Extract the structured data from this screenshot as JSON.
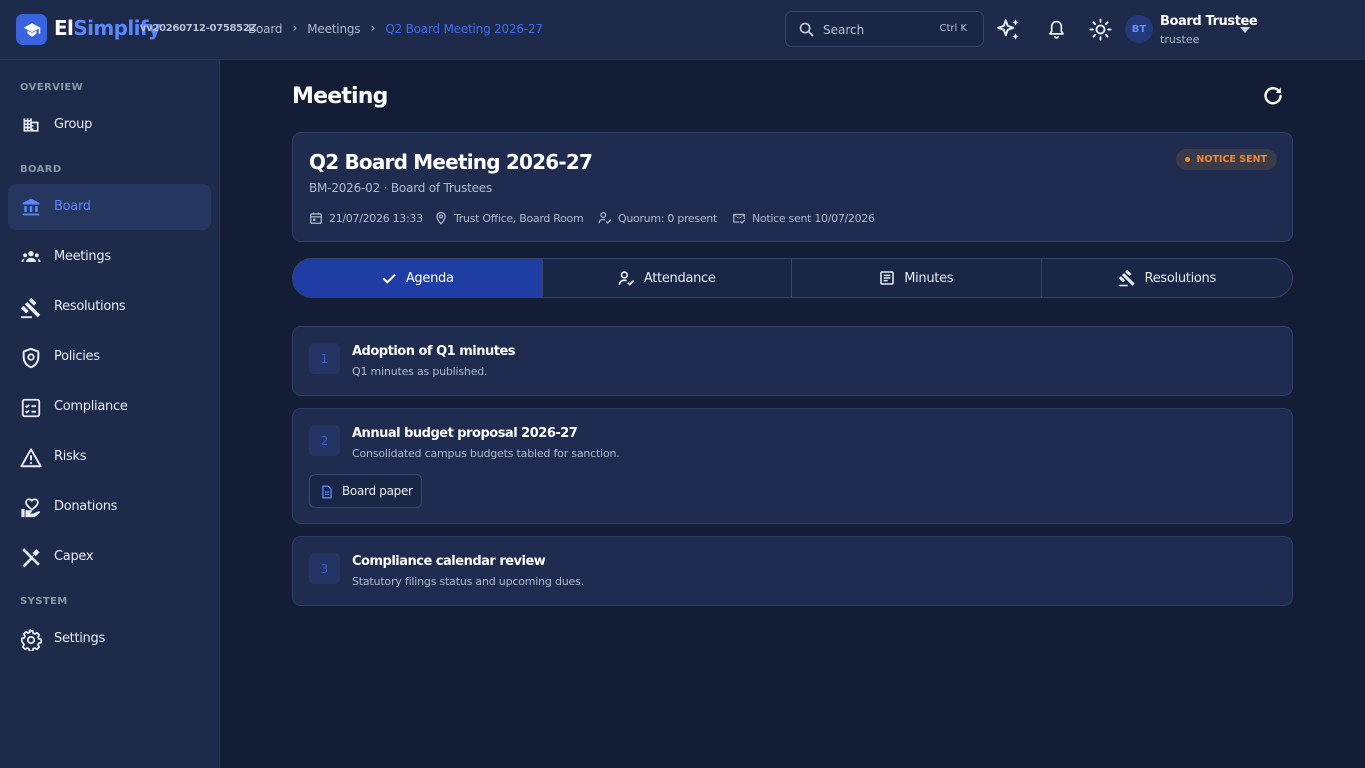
{
  "app": {
    "brand_prefix": "El",
    "brand_suffix": "Simplify",
    "version": "vv20260712-075852Z"
  },
  "breadcrumb": [
    "Board",
    "Meetings",
    "Q2 Board Meeting 2026-27"
  ],
  "search": {
    "placeholder": "Search",
    "shortcut": "Ctrl K"
  },
  "user": {
    "initials": "BT",
    "name": "Board Trustee",
    "role": "trustee"
  },
  "sidebar": {
    "sections": [
      "OVERVIEW",
      "BOARD",
      "SYSTEM"
    ],
    "items": [
      {
        "label": "Group",
        "icon": "building-icon"
      },
      {
        "label": "Board",
        "icon": "bank-icon",
        "active": true
      },
      {
        "label": "Meetings",
        "icon": "people-icon"
      },
      {
        "label": "Resolutions",
        "icon": "gavel-icon"
      },
      {
        "label": "Policies",
        "icon": "shield-icon"
      },
      {
        "label": "Compliance",
        "icon": "checklist-icon"
      },
      {
        "label": "Risks",
        "icon": "warning-icon"
      },
      {
        "label": "Donations",
        "icon": "donation-icon"
      },
      {
        "label": "Capex",
        "icon": "tools-icon"
      },
      {
        "label": "Settings",
        "icon": "gear-icon"
      }
    ]
  },
  "page": {
    "title": "Meeting"
  },
  "meeting": {
    "title": "Q2 Board Meeting 2026-27",
    "subtitle": "BM-2026-02 · Board of Trustees",
    "status": "NOTICE SENT",
    "datetime": "21/07/2026 13:33",
    "location": "Trust Office, Board Room",
    "quorum": "Quorum: 0 present",
    "notice": "Notice sent 10/07/2026"
  },
  "tabs": [
    {
      "label": "Agenda",
      "icon": "check-icon",
      "active": true
    },
    {
      "label": "Attendance",
      "icon": "attendance-icon"
    },
    {
      "label": "Minutes",
      "icon": "document-icon"
    },
    {
      "label": "Resolutions",
      "icon": "gavel-icon"
    }
  ],
  "agenda": [
    {
      "number": "1",
      "title": "Adoption of Q1 minutes",
      "description": "Q1 minutes as published."
    },
    {
      "number": "2",
      "title": "Annual budget proposal 2026-27",
      "description": "Consolidated campus budgets tabled for sanction.",
      "attachment": "Board paper"
    },
    {
      "number": "3",
      "title": "Compliance calendar review",
      "description": "Statutory filings status and upcoming dues."
    }
  ],
  "colors": {
    "accent": "#5a86ff",
    "active_tab": "#1f3ea5",
    "status_badge": "#f0883a",
    "background": "#141d36",
    "surface": "#1f2c4f"
  }
}
